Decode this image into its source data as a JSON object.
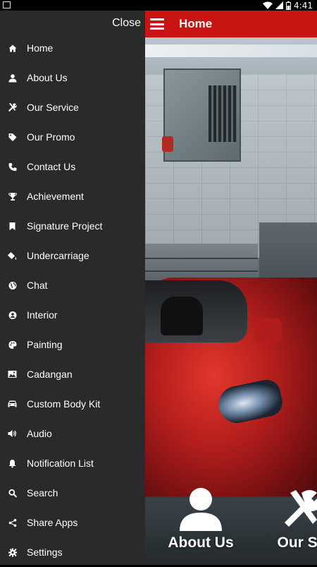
{
  "status_bar": {
    "time": "4:41"
  },
  "app_bar": {
    "title": "Home"
  },
  "drawer": {
    "close_label": "Close",
    "items": [
      {
        "label": "Home",
        "icon": "home-icon"
      },
      {
        "label": "About Us",
        "icon": "person-icon"
      },
      {
        "label": "Our Service",
        "icon": "tools-icon"
      },
      {
        "label": "Our Promo",
        "icon": "tag-icon"
      },
      {
        "label": "Contact Us",
        "icon": "phone-icon"
      },
      {
        "label": "Achievement",
        "icon": "trophy-icon"
      },
      {
        "label": "Signature Project",
        "icon": "bookmark-icon"
      },
      {
        "label": "Undercarriage",
        "icon": "paint-bucket-icon"
      },
      {
        "label": "Chat",
        "icon": "globe-icon"
      },
      {
        "label": "Interior",
        "icon": "user-circle-icon"
      },
      {
        "label": "Painting",
        "icon": "palette-icon"
      },
      {
        "label": "Cadangan",
        "icon": "image-icon"
      },
      {
        "label": "Custom Body Kit",
        "icon": "car-icon"
      },
      {
        "label": "Audio",
        "icon": "speaker-icon"
      },
      {
        "label": "Notification List",
        "icon": "bell-icon"
      },
      {
        "label": "Search",
        "icon": "search-icon"
      },
      {
        "label": "Share Apps",
        "icon": "share-icon"
      },
      {
        "label": "Settings",
        "icon": "gear-icon"
      }
    ]
  },
  "bottom_menu": {
    "about": "About Us",
    "service": "Our Ser"
  },
  "colors": {
    "accent": "#c81412",
    "drawer_bg": "#2a2a2a"
  }
}
